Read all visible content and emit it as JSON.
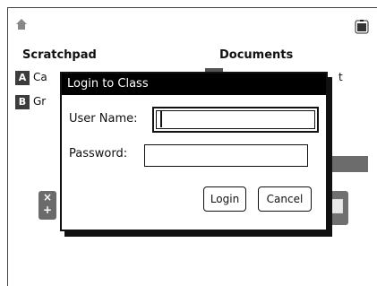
{
  "app": {
    "headings": {
      "scratchpad": "Scratchpad",
      "documents": "Documents"
    },
    "scratchpad_items": [
      {
        "badge": "A",
        "label": "Ca"
      },
      {
        "badge": "B",
        "label": "Gr"
      }
    ],
    "documents_item_tail": "t",
    "icons": {
      "home": "home-icon",
      "battery": "battery-icon",
      "calculator": "calculator-icon",
      "document": "document-icon"
    }
  },
  "dialog": {
    "title": "Login to Class",
    "username_label": "User Name:",
    "username_value": "",
    "password_label": "Password:",
    "password_value": "",
    "login_label": "Login",
    "cancel_label": "Cancel"
  }
}
